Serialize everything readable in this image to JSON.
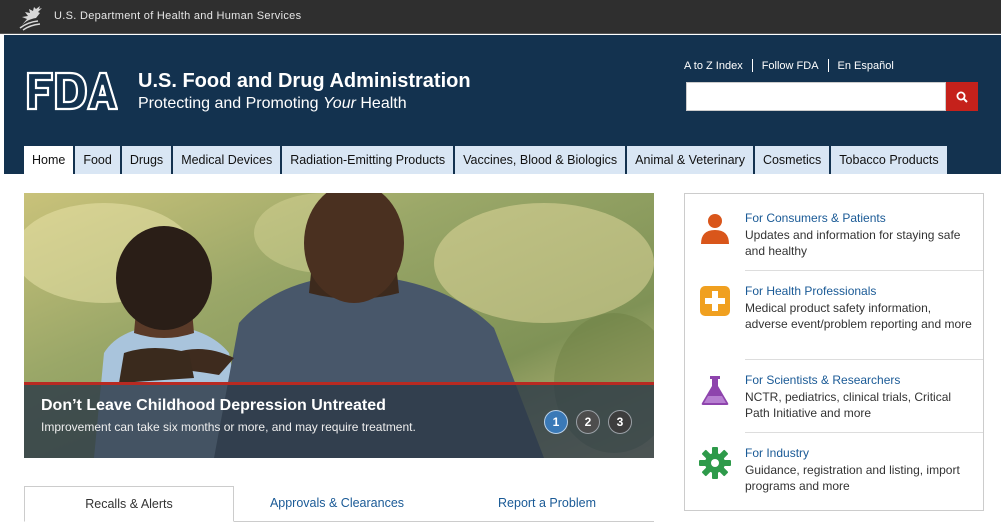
{
  "hhs_bar": {
    "text": "U.S. Department of Health and Human Services"
  },
  "header": {
    "logo_text": "FDA",
    "agency_name": "U.S. Food and Drug Administration",
    "tagline_prefix": "Protecting and Promoting ",
    "tagline_em": "Your",
    "tagline_suffix": " Health",
    "utility_links": [
      "A to Z Index",
      "Follow FDA",
      "En Español"
    ],
    "search": {
      "value": "",
      "placeholder": ""
    }
  },
  "nav": {
    "tabs": [
      "Home",
      "Food",
      "Drugs",
      "Medical Devices",
      "Radiation-Emitting Products",
      "Vaccines, Blood & Biologics",
      "Animal & Veterinary",
      "Cosmetics",
      "Tobacco Products"
    ],
    "active": "Home"
  },
  "hero": {
    "title": "Don’t Leave Childhood Depression Untreated",
    "subtitle": "Improvement can take six months or more, and may require treatment.",
    "slides": [
      "1",
      "2",
      "3"
    ],
    "active_slide": "1"
  },
  "bottom_tabs": {
    "tabs": [
      "Recalls & Alerts",
      "Approvals & Clearances",
      "Report a Problem"
    ],
    "active": "Recalls & Alerts"
  },
  "audiences": [
    {
      "title": "For Consumers & Patients",
      "desc": "Updates and information for staying safe and healthy",
      "icon": "person-icon",
      "color": "#d9561b"
    },
    {
      "title": "For Health Professionals",
      "desc": "Medical product safety information, adverse event/problem reporting and more",
      "icon": "medical-cross-icon",
      "color": "#f0a020"
    },
    {
      "title": "For Scientists & Researchers",
      "desc": "NCTR, pediatrics, clinical trials, Critical Path Initiative and more",
      "icon": "flask-icon",
      "color": "#8e44ad"
    },
    {
      "title": "For Industry",
      "desc": "Guidance, registration and listing, import programs and more",
      "icon": "gear-icon",
      "color": "#2e9a4a"
    }
  ],
  "colors": {
    "header_bg": "#13324f",
    "hhs_bg": "#2f2f2f",
    "nav_tab_bg": "#d9e6f4",
    "search_button": "#c5211b",
    "link": "#1a5a96",
    "hero_accent": "#b82a22"
  }
}
